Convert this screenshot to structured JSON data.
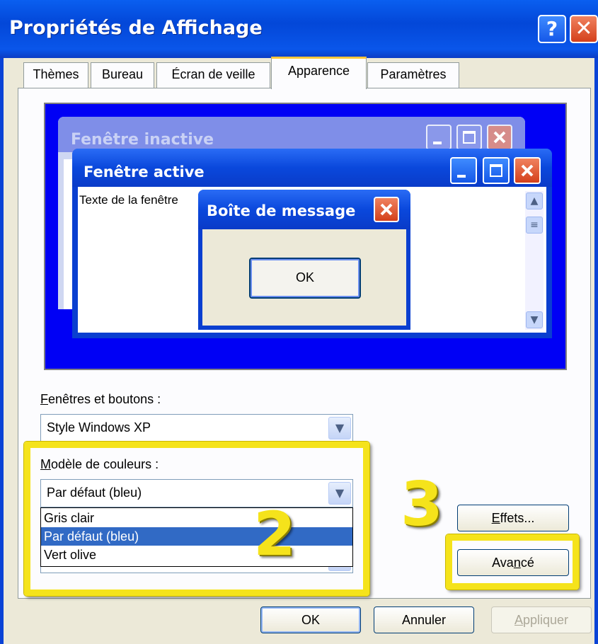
{
  "window": {
    "title": "Propriétés de Affichage",
    "help_glyph": "?",
    "close_glyph": "✕"
  },
  "tabs": [
    {
      "label": "Thèmes",
      "selected": false
    },
    {
      "label": "Bureau",
      "selected": false
    },
    {
      "label": "Écran de veille",
      "selected": false
    },
    {
      "label": "Apparence",
      "selected": true
    },
    {
      "label": "Paramètres",
      "selected": false
    }
  ],
  "preview": {
    "inactive_title": "Fenêtre inactive",
    "active_title": "Fenêtre active",
    "window_text": "Texte de la fenêtre",
    "message_title": "Boîte de message",
    "message_ok": "OK"
  },
  "windows_buttons": {
    "label_first": "F",
    "label_rest": "enêtres et boutons :",
    "value": "Style Windows XP"
  },
  "color_scheme": {
    "label_first": "M",
    "label_rest": "odèle de couleurs :",
    "value": "Par défaut (bleu)",
    "options": [
      "Gris clair",
      "Par défaut (bleu)",
      "Vert olive"
    ],
    "selected_index": 1
  },
  "buttons": {
    "effects_first": "E",
    "effects_rest": "ffets...",
    "advanced_before": "Ava",
    "advanced_key": "n",
    "advanced_after": "cé",
    "ok": "OK",
    "cancel": "Annuler",
    "apply_first": "A",
    "apply_rest": "ppliquer"
  },
  "annotations": {
    "step_2": "2",
    "step_3": "3"
  },
  "colors": {
    "titlebar": "#0a56ea",
    "dialog_bg": "#ece9d8",
    "preview_desktop": "#0000f5",
    "highlight_box": "#f5e31b",
    "selection": "#316ac5"
  }
}
